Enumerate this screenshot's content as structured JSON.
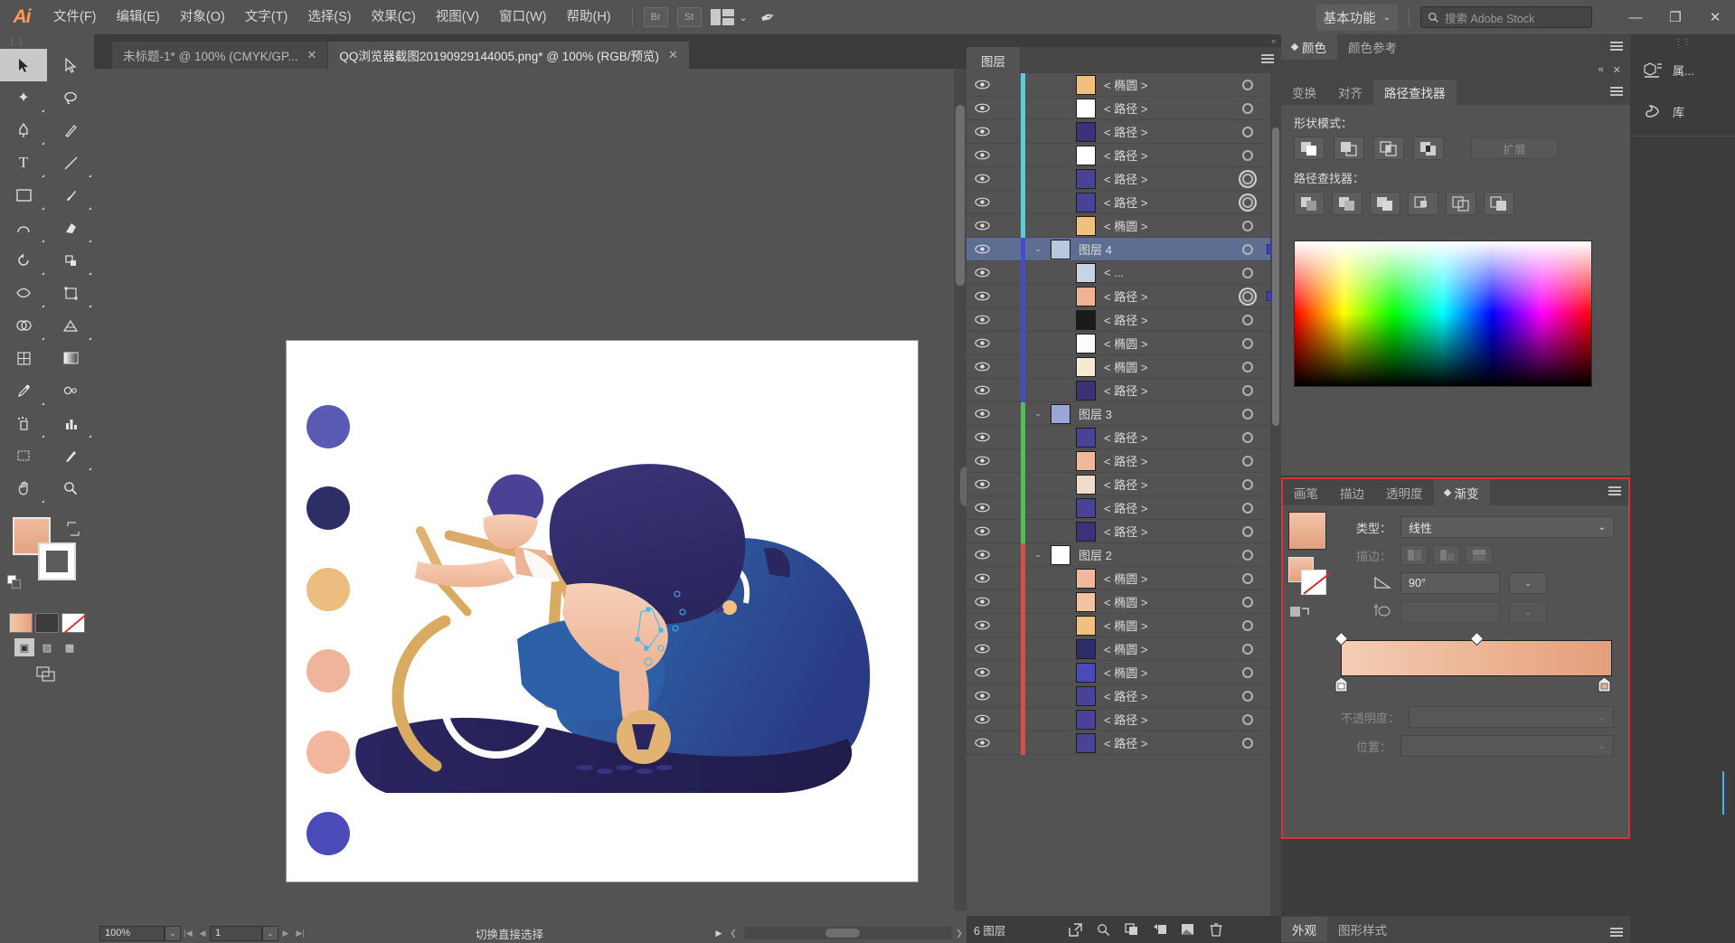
{
  "app": {
    "logo": "Ai",
    "menus": [
      "文件(F)",
      "编辑(E)",
      "对象(O)",
      "文字(T)",
      "选择(S)",
      "效果(C)",
      "视图(V)",
      "窗口(W)",
      "帮助(H)"
    ],
    "bridge_label": "Br",
    "stock_label": "St",
    "workspace": "基本功能",
    "search_placeholder": "搜索 Adobe Stock",
    "window_minimize": "—",
    "window_restore": "❐",
    "window_close": "✕"
  },
  "tabs": [
    {
      "title": "未标题-1* @ 100% (CMYK/GP...",
      "close": "✕",
      "active": false
    },
    {
      "title": "QQ浏览器截图20190929144005.png* @ 100% (RGB/预览)",
      "close": "✕",
      "active": true
    }
  ],
  "toolbar": {
    "tools": [
      {
        "name": "selection-tool",
        "glyph": "➤",
        "selected": true
      },
      {
        "name": "direct-selection-tool",
        "glyph": "↗",
        "selected": false
      },
      {
        "name": "magic-wand-tool",
        "glyph": "✦",
        "selected": false
      },
      {
        "name": "lasso-tool",
        "glyph": "৹",
        "selected": false
      },
      {
        "name": "pen-tool",
        "glyph": "✒",
        "selected": false
      },
      {
        "name": "curvature-tool",
        "glyph": "✎",
        "selected": false
      },
      {
        "name": "type-tool",
        "glyph": "T",
        "selected": false
      },
      {
        "name": "line-segment-tool",
        "glyph": "╱",
        "selected": false
      },
      {
        "name": "rectangle-tool",
        "glyph": "▭",
        "selected": false
      },
      {
        "name": "paintbrush-tool",
        "glyph": "🖌",
        "selected": false
      },
      {
        "name": "shaper-tool",
        "glyph": "◠",
        "selected": false
      },
      {
        "name": "eraser-tool",
        "glyph": "◣",
        "selected": false
      },
      {
        "name": "rotate-tool",
        "glyph": "↻",
        "selected": false
      },
      {
        "name": "scale-tool",
        "glyph": "⤢",
        "selected": false
      },
      {
        "name": "width-tool",
        "glyph": "⌇",
        "selected": false
      },
      {
        "name": "free-transform-tool",
        "glyph": "✥",
        "selected": false
      },
      {
        "name": "shape-builder-tool",
        "glyph": "◍",
        "selected": false
      },
      {
        "name": "perspective-grid-tool",
        "glyph": "⊿",
        "selected": false
      },
      {
        "name": "mesh-tool",
        "glyph": "▦",
        "selected": false
      },
      {
        "name": "gradient-tool",
        "glyph": "▤",
        "selected": false
      },
      {
        "name": "eyedropper-tool",
        "glyph": "✎",
        "selected": false
      },
      {
        "name": "blend-tool",
        "glyph": "⬯",
        "selected": false
      },
      {
        "name": "symbol-sprayer-tool",
        "glyph": "⁂",
        "selected": false
      },
      {
        "name": "column-graph-tool",
        "glyph": "▥",
        "selected": false
      },
      {
        "name": "artboard-tool",
        "glyph": "⬚",
        "selected": false
      },
      {
        "name": "slice-tool",
        "glyph": "✂",
        "selected": false
      },
      {
        "name": "hand-tool",
        "glyph": "✋",
        "selected": false
      },
      {
        "name": "zoom-tool",
        "glyph": "🔍",
        "selected": false
      }
    ],
    "fill_color": "#eeb394",
    "stroke_color": "#ffffff"
  },
  "canvas": {
    "dots": [
      {
        "color": "#5a5ab4"
      },
      {
        "color": "#2e2e66"
      },
      {
        "color": "#edbd7f"
      },
      {
        "color": "#f0b49b"
      },
      {
        "color": "#f2b79c"
      },
      {
        "color": "#4a4ab8"
      }
    ],
    "artboard_bg": "#ffffff"
  },
  "statusbar": {
    "zoom": "100%",
    "page": "1",
    "status_text": "切换直接选择",
    "nav_first": "|◀",
    "nav_prev": "◀",
    "nav_next": "▶",
    "nav_last": "▶|"
  },
  "layers_panel": {
    "tab_label": "图层",
    "footer_count": "6 图层",
    "footer_icons": [
      "locate-object-icon",
      "make-clipping-mask-icon",
      "make-sublayer-icon",
      "new-sublayer-icon",
      "new-layer-icon",
      "delete-layer-icon"
    ],
    "rows": [
      {
        "name": "< 椭圆 >",
        "depth": 2,
        "color": "#46d8e0",
        "thumb": "#f0c07e",
        "selected": false,
        "target": "ring",
        "has_sel": false,
        "expander": ""
      },
      {
        "name": "< 路径 >",
        "depth": 2,
        "color": "#46d8e0",
        "thumb": "#ffffff",
        "selected": false,
        "target": "ring",
        "has_sel": false,
        "expander": ""
      },
      {
        "name": "< 路径 >",
        "depth": 2,
        "color": "#46d8e0",
        "thumb": "#3b3277",
        "selected": false,
        "target": "ring",
        "has_sel": false,
        "expander": ""
      },
      {
        "name": "< 路径 >",
        "depth": 2,
        "color": "#46d8e0",
        "thumb": "#ffffff",
        "selected": false,
        "target": "ring",
        "has_sel": false,
        "expander": ""
      },
      {
        "name": "< 路径 >",
        "depth": 2,
        "color": "#46d8e0",
        "thumb": "#4a4294",
        "selected": false,
        "target": "ring2",
        "has_sel": false,
        "expander": ""
      },
      {
        "name": "< 路径 >",
        "depth": 2,
        "color": "#46d8e0",
        "thumb": "#4a4294",
        "selected": false,
        "target": "ring2",
        "has_sel": false,
        "expander": ""
      },
      {
        "name": "< 椭圆 >",
        "depth": 2,
        "color": "#46d8e0",
        "thumb": "#f0c07e",
        "selected": false,
        "target": "ring",
        "has_sel": false,
        "expander": ""
      },
      {
        "name": "图层 4",
        "depth": 0,
        "color": "#4646e0",
        "thumb": "#b8c8e0",
        "selected": true,
        "target": "ring",
        "has_sel": true,
        "expander": "v"
      },
      {
        "name": "< ...",
        "depth": 2,
        "color": "#4646e0",
        "thumb": "#c8d4e4",
        "selected": false,
        "target": "ring",
        "has_sel": false,
        "expander": ""
      },
      {
        "name": "< 路径 >",
        "depth": 2,
        "color": "#4646e0",
        "thumb": "#eeb394",
        "selected": false,
        "target": "ring2",
        "has_sel": true,
        "expander": ""
      },
      {
        "name": "< 路径 >",
        "depth": 2,
        "color": "#4646e0",
        "thumb": "#1a1a1a",
        "selected": false,
        "target": "ring",
        "has_sel": false,
        "expander": ""
      },
      {
        "name": "< 椭圆 >",
        "depth": 2,
        "color": "#4646e0",
        "thumb": "#fdfdfd",
        "selected": false,
        "target": "ring",
        "has_sel": false,
        "expander": ""
      },
      {
        "name": "< 椭圆 >",
        "depth": 2,
        "color": "#4646e0",
        "thumb": "#f7ead3",
        "selected": false,
        "target": "ring",
        "has_sel": false,
        "expander": ""
      },
      {
        "name": "< 路径 >",
        "depth": 2,
        "color": "#4646e0",
        "thumb": "#3a3272",
        "selected": false,
        "target": "ring",
        "has_sel": false,
        "expander": ""
      },
      {
        "name": "图层 3",
        "depth": 0,
        "color": "#3ecb4a",
        "thumb": "#9aa6d8",
        "selected": false,
        "target": "ring",
        "has_sel": false,
        "expander": "v"
      },
      {
        "name": "< 路径 >",
        "depth": 2,
        "color": "#3ecb4a",
        "thumb": "#4a4294",
        "selected": false,
        "target": "ring",
        "has_sel": false,
        "expander": ""
      },
      {
        "name": "< 路径 >",
        "depth": 2,
        "color": "#3ecb4a",
        "thumb": "#f0b89c",
        "selected": false,
        "target": "ring",
        "has_sel": false,
        "expander": ""
      },
      {
        "name": "< 路径 >",
        "depth": 2,
        "color": "#3ecb4a",
        "thumb": "#eedcc8",
        "selected": false,
        "target": "ring",
        "has_sel": false,
        "expander": ""
      },
      {
        "name": "< 路径 >",
        "depth": 2,
        "color": "#3ecb4a",
        "thumb": "#4a4294",
        "selected": false,
        "target": "ring",
        "has_sel": false,
        "expander": ""
      },
      {
        "name": "< 路径 >",
        "depth": 2,
        "color": "#3ecb4a",
        "thumb": "#3b3277",
        "selected": false,
        "target": "ring",
        "has_sel": false,
        "expander": ""
      },
      {
        "name": "图层 2",
        "depth": 0,
        "color": "#e8493b",
        "thumb": "#ffffff",
        "selected": false,
        "target": "ring",
        "has_sel": false,
        "expander": "v"
      },
      {
        "name": "< 椭圆 >",
        "depth": 2,
        "color": "#e8493b",
        "thumb": "#f0b89c",
        "selected": false,
        "target": "ring",
        "has_sel": false,
        "expander": ""
      },
      {
        "name": "< 椭圆 >",
        "depth": 2,
        "color": "#e8493b",
        "thumb": "#f2c39f",
        "selected": false,
        "target": "ring",
        "has_sel": false,
        "expander": ""
      },
      {
        "name": "< 椭圆 >",
        "depth": 2,
        "color": "#e8493b",
        "thumb": "#f0c07e",
        "selected": false,
        "target": "ring",
        "has_sel": false,
        "expander": ""
      },
      {
        "name": "< 椭圆 >",
        "depth": 2,
        "color": "#e8493b",
        "thumb": "#2e2e66",
        "selected": false,
        "target": "ring",
        "has_sel": false,
        "expander": ""
      },
      {
        "name": "< 椭圆 >",
        "depth": 2,
        "color": "#e8493b",
        "thumb": "#4a4ab8",
        "selected": false,
        "target": "ring",
        "has_sel": false,
        "expander": ""
      },
      {
        "name": "< 路径 >",
        "depth": 2,
        "color": "#e8493b",
        "thumb": "#4a4294",
        "selected": false,
        "target": "ring",
        "has_sel": false,
        "expander": ""
      },
      {
        "name": "< 路径 >",
        "depth": 2,
        "color": "#e8493b",
        "thumb": "#4a4294",
        "selected": false,
        "target": "ring",
        "has_sel": false,
        "expander": ""
      },
      {
        "name": "< 路径 >",
        "depth": 2,
        "color": "#e8493b",
        "thumb": "#4a4294",
        "selected": false,
        "target": "ring",
        "has_sel": false,
        "expander": ""
      }
    ]
  },
  "color_panel": {
    "tabs": [
      {
        "label": "颜色",
        "active": true
      },
      {
        "label": "颜色参考",
        "active": false
      }
    ],
    "collapse": "«",
    "close": "✕"
  },
  "pathfinder_panel": {
    "tabs": [
      {
        "label": "变换",
        "active": false
      },
      {
        "label": "对齐",
        "active": false
      },
      {
        "label": "路径查找器",
        "active": true
      }
    ],
    "shape_modes_label": "形状模式：",
    "pathfinders_label": "路径查找器：",
    "expand_label": "扩展",
    "shape_mode_buttons": [
      "unite-icon",
      "minus-front-icon",
      "intersect-icon",
      "exclude-icon"
    ],
    "pathfinder_buttons": [
      "divide-icon",
      "trim-icon",
      "merge-icon",
      "crop-icon",
      "outline-icon",
      "minus-back-icon"
    ]
  },
  "gradient_panel": {
    "tabs": [
      {
        "label": "画笔",
        "active": false
      },
      {
        "label": "描边",
        "active": false
      },
      {
        "label": "透明度",
        "active": false
      },
      {
        "label": "渐变",
        "active": true
      }
    ],
    "type_label": "类型：",
    "type_value": "线性",
    "stroke_label": "描边：",
    "angle_label": "angle-icon",
    "angle_value": "90°",
    "aspect_label": "aspect-ratio-icon",
    "aspect_value": "",
    "opacity_label": "不透明度：",
    "opacity_value": "",
    "location_label": "位置：",
    "location_value": "",
    "gradient_start": "#f4cdb5",
    "gradient_end": "#e49e79",
    "delete_stop_icon": "trash-icon",
    "highlight_color": "#d83434"
  },
  "appearance_panel": {
    "tabs": [
      {
        "label": "外观",
        "active": true
      },
      {
        "label": "图形样式",
        "active": false
      }
    ]
  },
  "rail": {
    "items": [
      {
        "label": "属...",
        "icon": "properties-icon"
      },
      {
        "label": "库",
        "icon": "libraries-icon"
      }
    ]
  }
}
